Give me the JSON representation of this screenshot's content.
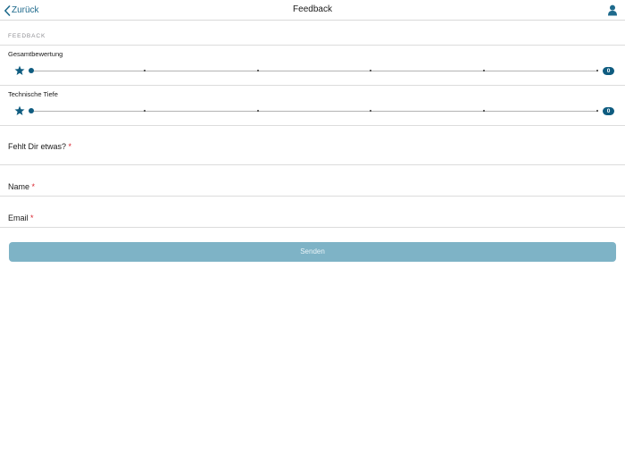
{
  "nav": {
    "back_label": "Zurück",
    "title": "Feedback",
    "user_icon": "user-icon"
  },
  "section": {
    "header": "FEEDBACK"
  },
  "ratings": [
    {
      "label": "Gesamtbewertung",
      "value": "0",
      "min": 0,
      "max": 5,
      "icon": "star-icon"
    },
    {
      "label": "Technische Tiefe",
      "value": "0",
      "min": 0,
      "max": 5,
      "icon": "star-icon"
    }
  ],
  "fields": {
    "missing": {
      "label": "Fehlt Dir etwas?",
      "required_mark": "*",
      "value": ""
    },
    "name": {
      "label": "Name",
      "required_mark": "*",
      "value": ""
    },
    "email": {
      "label": "Email",
      "required_mark": "*",
      "value": ""
    }
  },
  "submit": {
    "label": "Senden"
  },
  "colors": {
    "accent": "#0f5c80",
    "link": "#1e6a8c",
    "button_disabled": "#7eb3c6",
    "required": "#d9232e"
  }
}
